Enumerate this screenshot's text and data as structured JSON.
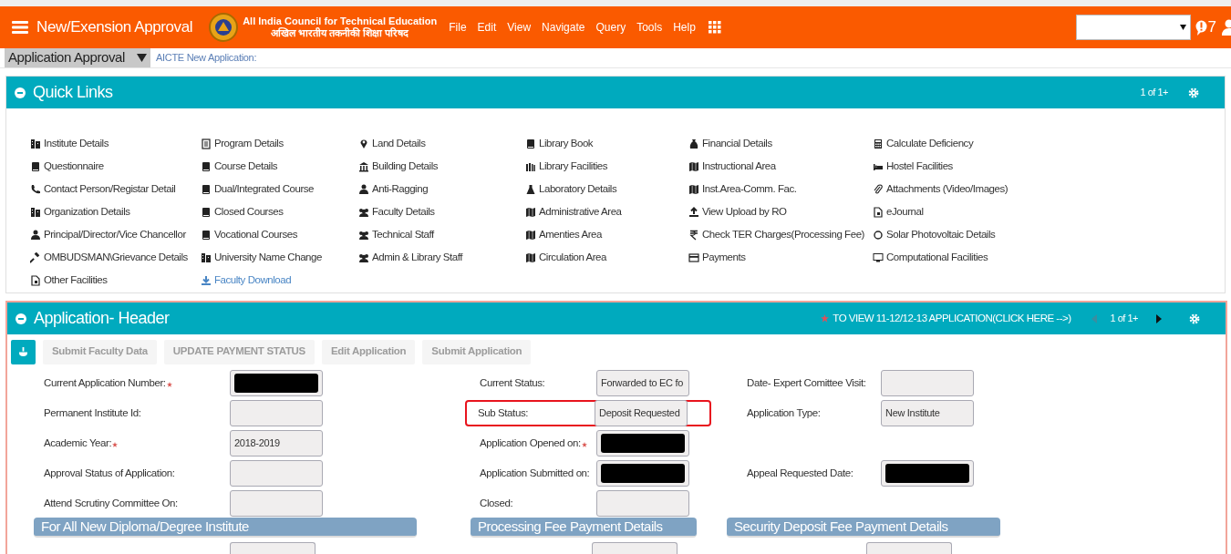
{
  "header": {
    "title": "New/Exension Approval",
    "org_name": "All India Council for Technical Education",
    "org_name_hindi": "अखिल भारतीय तकनीकी शिक्षा परिषद",
    "menu": [
      "File",
      "Edit",
      "View",
      "Navigate",
      "Query",
      "Tools",
      "Help"
    ],
    "notifications": "7"
  },
  "subbar": {
    "module": "Application Approval",
    "breadcrumb": "AICTE New Application:"
  },
  "quick_links": {
    "title": "Quick Links",
    "pager": "1 of 1+",
    "columns": [
      [
        {
          "label": "Institute Details",
          "kind": "entry"
        },
        {
          "label": "Questionnaire",
          "kind": "entry"
        },
        {
          "label": "Contact Person/Registar Detail",
          "kind": "entry"
        },
        {
          "label": "Organization Details",
          "kind": "entry"
        },
        {
          "label": "Principal/Director/Vice Chancellor",
          "kind": "entry"
        },
        {
          "label": "OMBUDSMAN\\Grievance Details",
          "kind": "entry"
        },
        {
          "label": "Other Facilities",
          "kind": "entry"
        }
      ],
      [
        {
          "label": "Program Details",
          "kind": "entry"
        },
        {
          "label": "Course Details",
          "kind": "entry"
        },
        {
          "label": "Dual/Integrated Course",
          "kind": "entry"
        },
        {
          "label": "Closed Courses",
          "kind": "entry"
        },
        {
          "label": "Vocational Courses",
          "kind": "entry"
        },
        {
          "label": "University Name Change",
          "kind": "entry"
        },
        {
          "label": "Faculty Download",
          "kind": "download"
        }
      ],
      [
        {
          "label": "Land Details",
          "kind": "entry"
        },
        {
          "label": "Building Details",
          "kind": "entry"
        },
        {
          "label": "Anti-Ragging",
          "kind": "entry"
        },
        {
          "label": "Faculty Details",
          "kind": "entry"
        },
        {
          "label": "Technical Staff",
          "kind": "entry"
        },
        {
          "label": "Admin & Library Staff",
          "kind": "entry"
        }
      ],
      [
        {
          "label": "Library Book",
          "kind": "entry"
        },
        {
          "label": "Library Facilities",
          "kind": "entry"
        },
        {
          "label": "Laboratory Details",
          "kind": "entry"
        },
        {
          "label": "Administrative Area",
          "kind": "entry"
        },
        {
          "label": "Amenties Area",
          "kind": "entry"
        },
        {
          "label": "Circulation Area",
          "kind": "entry"
        }
      ],
      [
        {
          "label": "Financial Details",
          "kind": "entry"
        },
        {
          "label": "Instructional Area",
          "kind": "entry"
        },
        {
          "label": "Inst.Area-Comm. Fac.",
          "kind": "entry"
        },
        {
          "label": "View Upload by RO",
          "kind": "entry"
        },
        {
          "label": "Check TER Charges(Processing Fee)",
          "kind": "entry"
        },
        {
          "label": "Payments",
          "kind": "entry"
        }
      ],
      [
        {
          "label": "Calculate Deficiency",
          "kind": "entry"
        },
        {
          "label": "Hostel Facilities",
          "kind": "entry"
        },
        {
          "label": "Attachments (Video/Images)",
          "kind": "entry"
        },
        {
          "label": "eJournal",
          "kind": "entry"
        },
        {
          "label": "Solar Photovoltaic Details",
          "kind": "entry"
        },
        {
          "label": "Computational Facilities",
          "kind": "entry"
        }
      ]
    ]
  },
  "application_header": {
    "title": "Application- Header",
    "notice": "TO VIEW 11-12/12-13 APPLICATION(CLICK HERE -->)",
    "pager": "1 of 1+",
    "buttons": [
      {
        "label": "Submit Faculty Data",
        "disabled": true
      },
      {
        "label": "UPDATE PAYMENT STATUS",
        "disabled": true
      },
      {
        "label": "Edit Application",
        "disabled": true
      },
      {
        "label": "Submit Application",
        "disabled": true
      }
    ],
    "columns": [
      [
        {
          "label": "Current Application Number:",
          "required": true,
          "redacted": true
        },
        {
          "label": "Permanent Institute Id:",
          "required": false,
          "redacted": false
        },
        {
          "label": "Academic Year:",
          "required": true,
          "redacted": false,
          "value": "2018-2019"
        },
        {
          "label": "Approval Status of Application:",
          "required": false,
          "redacted": false
        },
        {
          "label": "Attend Scrutiny Committee On:",
          "required": false,
          "redacted": false
        }
      ],
      [
        {
          "label": "Current Status:",
          "required": false,
          "redacted": false,
          "value": "Forwarded to EC fo"
        },
        {
          "label": "Sub Status:",
          "required": false,
          "redacted": false,
          "value": "Deposit Requested",
          "highlighted": true
        },
        {
          "label": "Application Opened on:",
          "required": true,
          "redacted": true
        },
        {
          "label": "Application Submitted on:",
          "required": false,
          "redacted": true
        },
        {
          "label": "Closed:",
          "required": false,
          "redacted": false
        }
      ],
      [
        {
          "label": "Date- Expert Comittee Visit:",
          "required": false,
          "redacted": false
        },
        {
          "label": "Application Type:",
          "required": false,
          "redacted": false,
          "value": "New Institute"
        },
        null,
        {
          "label": "Appeal Requested Date:",
          "required": false,
          "redacted": true
        },
        null
      ]
    ],
    "sections": [
      "For All New Diploma/Degree Institute",
      "Processing Fee Payment Details",
      "Security Deposit Fee Payment Details"
    ]
  }
}
